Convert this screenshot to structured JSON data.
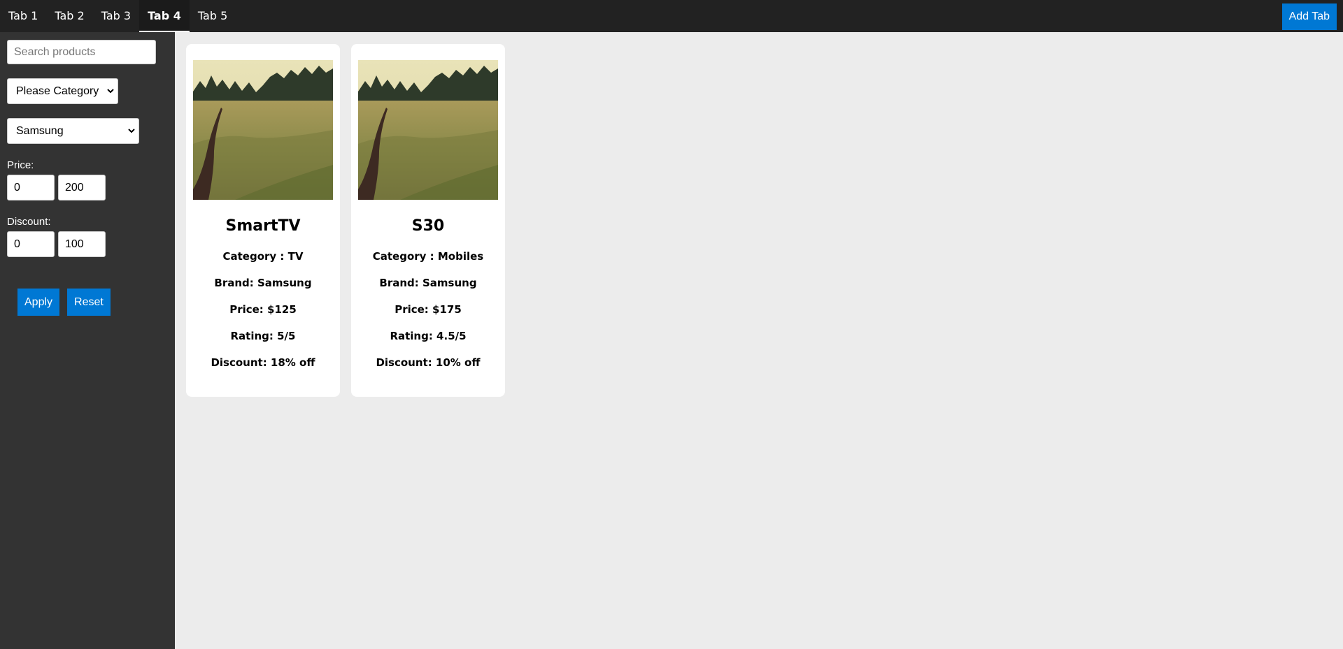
{
  "tabs": [
    {
      "label": "Tab 1",
      "active": false
    },
    {
      "label": "Tab 2",
      "active": false
    },
    {
      "label": "Tab 3",
      "active": false
    },
    {
      "label": "Tab 4",
      "active": true
    },
    {
      "label": "Tab 5",
      "active": false
    }
  ],
  "add_tab_label": "Add Tab",
  "filters": {
    "search_placeholder": "Search products",
    "search_value": "",
    "category_selected": "Please Category",
    "brand_selected": "Samsung",
    "price_label": "Price:",
    "price_min": "0",
    "price_max": "200",
    "discount_label": "Discount:",
    "discount_min": "0",
    "discount_max": "100",
    "apply_label": "Apply",
    "reset_label": "Reset"
  },
  "products": [
    {
      "name": "SmartTV",
      "category": "Category : TV",
      "brand": "Brand: Samsung",
      "price": "Price: $125",
      "rating": "Rating: 5/5",
      "discount": "Discount: 18% off"
    },
    {
      "name": "S30",
      "category": "Category : Mobiles",
      "brand": "Brand: Samsung",
      "price": "Price: $175",
      "rating": "Rating: 4.5/5",
      "discount": "Discount: 10% off"
    }
  ],
  "colors": {
    "topbar": "#222222",
    "sidebar": "#333333",
    "accent": "#0078d4",
    "content_bg": "#ececec"
  },
  "icons": {
    "select_chevron": "chevron-down-icon",
    "product_image": "meadow-landscape-photo"
  }
}
